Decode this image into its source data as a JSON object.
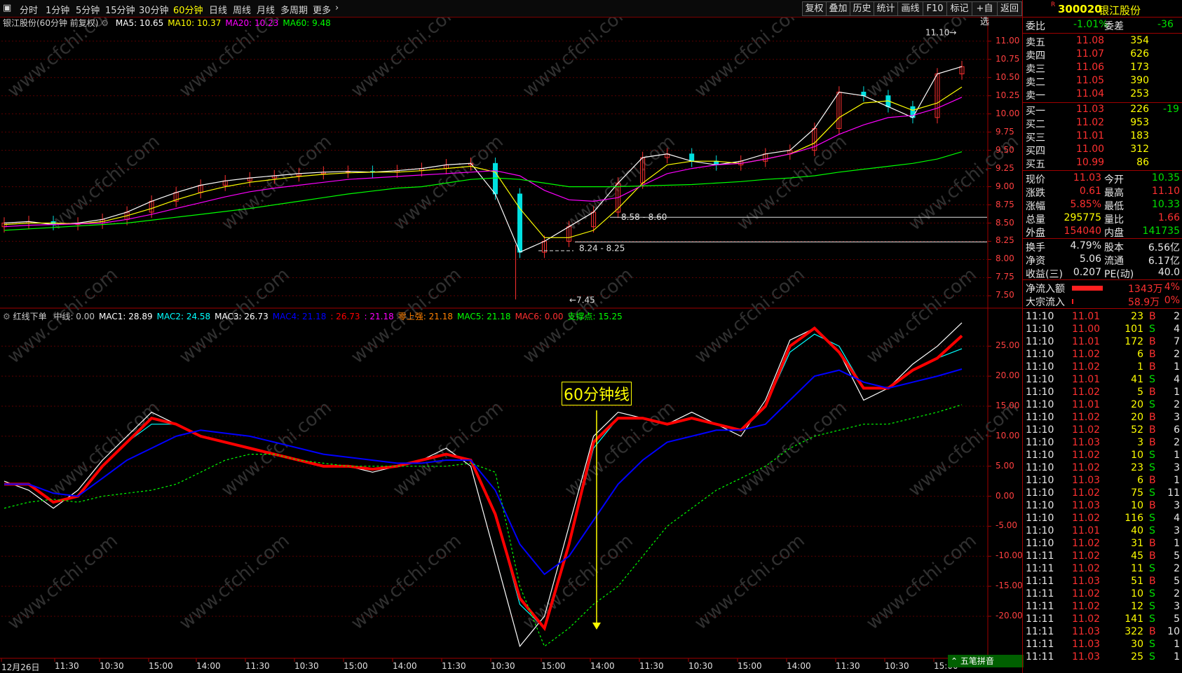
{
  "toolbar": {
    "periods": [
      "分时",
      "1分钟",
      "5分钟",
      "15分钟",
      "30分钟",
      "60分钟",
      "日线",
      "周线",
      "月线",
      "多周期",
      "更多"
    ],
    "active_period": "60分钟",
    "right_buttons": [
      "复权",
      "叠加",
      "历史",
      "统计",
      "画线",
      "F10",
      "标记",
      "+自选",
      "返回"
    ]
  },
  "main_chart": {
    "title": "银江股份(60分钟 前复权)",
    "ma_labels": [
      {
        "text": "MA5: 10.65",
        "color": "#ffffff"
      },
      {
        "text": "MA10: 10.37",
        "color": "#ffff00"
      },
      {
        "text": "MA20: 10.23",
        "color": "#ff00ff"
      },
      {
        "text": "MA60: 9.48",
        "color": "#00ff00"
      }
    ],
    "y_ticks": [
      "11.00",
      "10.75",
      "10.50",
      "10.25",
      "10.00",
      "9.75",
      "9.50",
      "9.25",
      "9.00",
      "8.75",
      "8.50",
      "8.25",
      "8.00",
      "7.75",
      "7.50"
    ],
    "annotations": {
      "high": "11.10",
      "low": "7.45",
      "zone1": "8.58 - 8.60",
      "zone2": "8.24 - 8.25"
    }
  },
  "indicator": {
    "name": "红线下单",
    "labels": [
      {
        "text": "中线: 0.00",
        "color": "#c0c0c0"
      },
      {
        "text": "MAC1: 28.89",
        "color": "#ffffff"
      },
      {
        "text": "MAC2: 24.58",
        "color": "#00ffff"
      },
      {
        "text": "MAC3: 26.73",
        "color": "#ffffff"
      },
      {
        "text": "MAC4: 21.18",
        "color": "#0000ff"
      },
      {
        "text": ": 26.73",
        "color": "#ff0000"
      },
      {
        "text": ": 21.18",
        "color": "#ff00ff"
      },
      {
        "text": "零上强: 21.18",
        "color": "#ff8000"
      },
      {
        "text": "MAC5: 21.18",
        "color": "#00ff00"
      },
      {
        "text": "MAC6: 0.00",
        "color": "#ff3030"
      },
      {
        "text": "支撑点: 15.25",
        "color": "#00ff00"
      }
    ],
    "y_ticks": [
      "25.00",
      "20.00",
      "15.00",
      "10.00",
      "5.00",
      "0.00",
      "-5.00",
      "-10.00",
      "-15.00",
      "-20.00"
    ],
    "callout": "60分钟线"
  },
  "x_axis": [
    "12月26日",
    "11:30",
    "10:30",
    "15:00",
    "14:00",
    "11:30",
    "10:30",
    "15:00",
    "14:00",
    "11:30",
    "10:30",
    "15:00",
    "14:00",
    "11:30",
    "10:30",
    "15:00",
    "14:00",
    "11:30",
    "10:30",
    "15:00"
  ],
  "watermark": "www.cfchi.com",
  "quote": {
    "code": "300020",
    "name": "银江股份",
    "weibi_label": "委比",
    "weibi": "-1.01%",
    "weicha_label": "委差",
    "weicha": "-36",
    "sells": [
      {
        "label": "卖五",
        "price": "11.08",
        "vol": "354"
      },
      {
        "label": "卖四",
        "price": "11.07",
        "vol": "626"
      },
      {
        "label": "卖三",
        "price": "11.06",
        "vol": "173"
      },
      {
        "label": "卖二",
        "price": "11.05",
        "vol": "390"
      },
      {
        "label": "卖一",
        "price": "11.04",
        "vol": "253"
      }
    ],
    "buys": [
      {
        "label": "买一",
        "price": "11.03",
        "vol": "226",
        "chg": "-19"
      },
      {
        "label": "买二",
        "price": "11.02",
        "vol": "953",
        "chg": ""
      },
      {
        "label": "买三",
        "price": "11.01",
        "vol": "183",
        "chg": ""
      },
      {
        "label": "买四",
        "price": "11.00",
        "vol": "312",
        "chg": ""
      },
      {
        "label": "买五",
        "price": "10.99",
        "vol": "86",
        "chg": ""
      }
    ],
    "stats": [
      {
        "l1": "现价",
        "v1": "11.03",
        "c1": "#ff3030",
        "l2": "今开",
        "v2": "10.35",
        "c2": "#00e000"
      },
      {
        "l1": "涨跌",
        "v1": "0.61",
        "c1": "#ff3030",
        "l2": "最高",
        "v2": "11.10",
        "c2": "#ff3030"
      },
      {
        "l1": "涨幅",
        "v1": "5.85%",
        "c1": "#ff3030",
        "l2": "最低",
        "v2": "10.33",
        "c2": "#00e000"
      },
      {
        "l1": "总量",
        "v1": "295775",
        "c1": "#ffff00",
        "l2": "量比",
        "v2": "1.66",
        "c2": "#ff3030"
      },
      {
        "l1": "外盘",
        "v1": "154040",
        "c1": "#ff3030",
        "l2": "内盘",
        "v2": "141735",
        "c2": "#00e000"
      }
    ],
    "stats2": [
      {
        "l1": "换手",
        "v1": "4.79%",
        "l2": "股本",
        "v2": "6.56亿"
      },
      {
        "l1": "净资",
        "v1": "5.06",
        "l2": "流通",
        "v2": "6.17亿"
      },
      {
        "l1": "收益(三)",
        "v1": "0.207",
        "l2": "PE(动)",
        "v2": "40.0"
      }
    ],
    "flows": [
      {
        "label": "净流入额",
        "val": "1343万",
        "pct": "4%",
        "bar": 0.55
      },
      {
        "label": "大宗流入",
        "val": "58.9万",
        "pct": "0%",
        "bar": 0.02
      }
    ]
  },
  "ticks": [
    [
      "11:10",
      "11.01",
      "23",
      "B",
      "2"
    ],
    [
      "11:10",
      "11.00",
      "101",
      "S",
      "4"
    ],
    [
      "11:10",
      "11.01",
      "172",
      "B",
      "7"
    ],
    [
      "11:10",
      "11.02",
      "6",
      "B",
      "2"
    ],
    [
      "11:10",
      "11.02",
      "1",
      "B",
      "1"
    ],
    [
      "11:10",
      "11.01",
      "41",
      "S",
      "4"
    ],
    [
      "11:10",
      "11.02",
      "5",
      "B",
      "1"
    ],
    [
      "11:10",
      "11.01",
      "20",
      "S",
      "2"
    ],
    [
      "11:10",
      "11.02",
      "20",
      "B",
      "3"
    ],
    [
      "11:10",
      "11.02",
      "52",
      "B",
      "6"
    ],
    [
      "11:10",
      "11.03",
      "3",
      "B",
      "2"
    ],
    [
      "11:10",
      "11.02",
      "10",
      "S",
      "1"
    ],
    [
      "11:10",
      "11.02",
      "23",
      "S",
      "3"
    ],
    [
      "11:10",
      "11.03",
      "6",
      "B",
      "1"
    ],
    [
      "11:10",
      "11.02",
      "75",
      "S",
      "11"
    ],
    [
      "11:10",
      "11.03",
      "10",
      "B",
      "3"
    ],
    [
      "11:10",
      "11.02",
      "116",
      "S",
      "4"
    ],
    [
      "11:10",
      "11.01",
      "40",
      "S",
      "3"
    ],
    [
      "11:10",
      "11.02",
      "31",
      "B",
      "1"
    ],
    [
      "11:11",
      "11.02",
      "45",
      "B",
      "5"
    ],
    [
      "11:11",
      "11.02",
      "11",
      "S",
      "2"
    ],
    [
      "11:11",
      "11.03",
      "51",
      "B",
      "5"
    ],
    [
      "11:11",
      "11.02",
      "10",
      "S",
      "2"
    ],
    [
      "11:11",
      "11.02",
      "12",
      "S",
      "3"
    ],
    [
      "11:11",
      "11.02",
      "141",
      "S",
      "5"
    ],
    [
      "11:11",
      "11.03",
      "322",
      "B",
      "10"
    ],
    [
      "11:11",
      "11.03",
      "30",
      "S",
      "1"
    ],
    [
      "11:11",
      "11.03",
      "25",
      "S",
      "1"
    ]
  ],
  "bottom_tag": "五笔拼音",
  "chart_data": [
    {
      "type": "line",
      "title": "银江股份(60分钟 前复权)",
      "ylim": [
        7.35,
        11.2
      ],
      "series": [
        {
          "name": "MA5",
          "color": "#ffffff",
          "values": [
            8.5,
            8.52,
            8.48,
            8.5,
            8.55,
            8.65,
            8.8,
            8.92,
            9.02,
            9.08,
            9.12,
            9.15,
            9.18,
            9.2,
            9.21,
            9.2,
            9.22,
            9.25,
            9.3,
            9.32,
            8.9,
            8.1,
            8.25,
            8.45,
            8.65,
            9.05,
            9.4,
            9.45,
            9.35,
            9.3,
            9.35,
            9.45,
            9.5,
            9.8,
            10.3,
            10.25,
            10.1,
            9.95,
            10.55,
            10.65
          ]
        },
        {
          "name": "MA10",
          "color": "#ffff00",
          "values": [
            8.48,
            8.5,
            8.5,
            8.49,
            8.52,
            8.6,
            8.7,
            8.82,
            8.92,
            9.0,
            9.06,
            9.1,
            9.14,
            9.17,
            9.19,
            9.2,
            9.2,
            9.22,
            9.25,
            9.28,
            9.2,
            8.7,
            8.3,
            8.3,
            8.4,
            8.7,
            9.05,
            9.3,
            9.35,
            9.35,
            9.32,
            9.38,
            9.45,
            9.6,
            9.95,
            10.15,
            10.18,
            10.05,
            10.15,
            10.37
          ]
        },
        {
          "name": "MA20",
          "color": "#ff00ff",
          "values": [
            8.45,
            8.47,
            8.48,
            8.49,
            8.5,
            8.55,
            8.62,
            8.7,
            8.78,
            8.86,
            8.93,
            8.98,
            9.02,
            9.06,
            9.1,
            9.12,
            9.14,
            9.16,
            9.18,
            9.2,
            9.22,
            9.15,
            8.95,
            8.82,
            8.8,
            8.85,
            9.02,
            9.18,
            9.25,
            9.3,
            9.32,
            9.38,
            9.45,
            9.55,
            9.72,
            9.85,
            9.95,
            9.98,
            10.08,
            10.23
          ]
        },
        {
          "name": "MA60",
          "color": "#00ff00",
          "values": [
            8.4,
            8.42,
            8.44,
            8.46,
            8.48,
            8.5,
            8.54,
            8.58,
            8.62,
            8.66,
            8.7,
            8.75,
            8.8,
            8.85,
            8.9,
            8.94,
            8.98,
            9.0,
            9.05,
            9.1,
            9.12,
            9.1,
            9.05,
            9.0,
            9.0,
            9.0,
            9.01,
            9.02,
            9.03,
            9.05,
            9.07,
            9.1,
            9.12,
            9.15,
            9.2,
            9.24,
            9.28,
            9.32,
            9.38,
            9.48
          ]
        }
      ]
    },
    {
      "type": "line",
      "title": "红线下单",
      "ylim": [
        -27,
        29
      ],
      "series": [
        {
          "name": "MAC1",
          "color": "#ffffff",
          "values": [
            2.5,
            1,
            -2,
            1,
            6,
            10,
            14,
            12,
            10,
            9,
            8,
            7,
            6,
            5,
            5,
            4,
            5,
            6,
            8,
            5,
            -10,
            -25,
            -20,
            -5,
            10,
            14,
            13,
            12,
            14,
            12,
            10,
            16,
            26,
            28,
            24,
            16,
            18,
            22,
            25,
            28.89
          ]
        },
        {
          "name": "MAC2",
          "color": "#00ffff",
          "values": [
            2,
            2,
            -1,
            0,
            5,
            9,
            12,
            12,
            10,
            9,
            8,
            7,
            6,
            5,
            5,
            4.5,
            5,
            6,
            7,
            6,
            -3,
            -18,
            -22,
            -8,
            8,
            13,
            13,
            12,
            13,
            12,
            11,
            15,
            24,
            27,
            25,
            18,
            18,
            21,
            23,
            24.58
          ]
        },
        {
          "name": "MAC3",
          "color": "#ff0000",
          "values": [
            2,
            2,
            -1,
            0,
            5,
            9,
            13,
            12,
            10,
            9,
            8,
            7,
            6,
            5,
            5,
            4.5,
            5,
            6,
            7,
            6,
            -3,
            -17,
            -22,
            -8,
            9,
            13,
            13,
            12,
            13,
            12,
            11,
            15,
            25,
            28,
            24,
            18,
            18,
            21,
            23,
            26.73
          ]
        },
        {
          "name": "MAC4",
          "color": "#0000ff",
          "values": [
            2,
            2,
            0.5,
            0,
            3,
            6,
            8,
            10,
            11,
            10.5,
            10,
            9,
            8,
            7,
            6.5,
            6,
            5.5,
            5.5,
            6,
            6,
            1,
            -8,
            -13,
            -10,
            -4,
            2,
            6,
            9,
            10,
            11,
            11,
            12,
            16,
            20,
            21,
            19,
            18,
            19,
            20,
            21.18
          ]
        },
        {
          "name": "支撑点",
          "color": "#00ff00",
          "values": [
            -2,
            -1,
            -0.5,
            -1,
            0,
            0.5,
            1,
            2,
            4,
            6,
            7,
            7,
            6,
            5.5,
            5,
            5,
            5,
            5,
            5,
            5.5,
            4,
            -15,
            -25,
            -22,
            -18,
            -15,
            -10,
            -5,
            -2,
            1,
            3,
            5,
            8,
            10,
            11,
            12,
            12,
            13,
            14,
            15.25
          ]
        }
      ]
    }
  ]
}
